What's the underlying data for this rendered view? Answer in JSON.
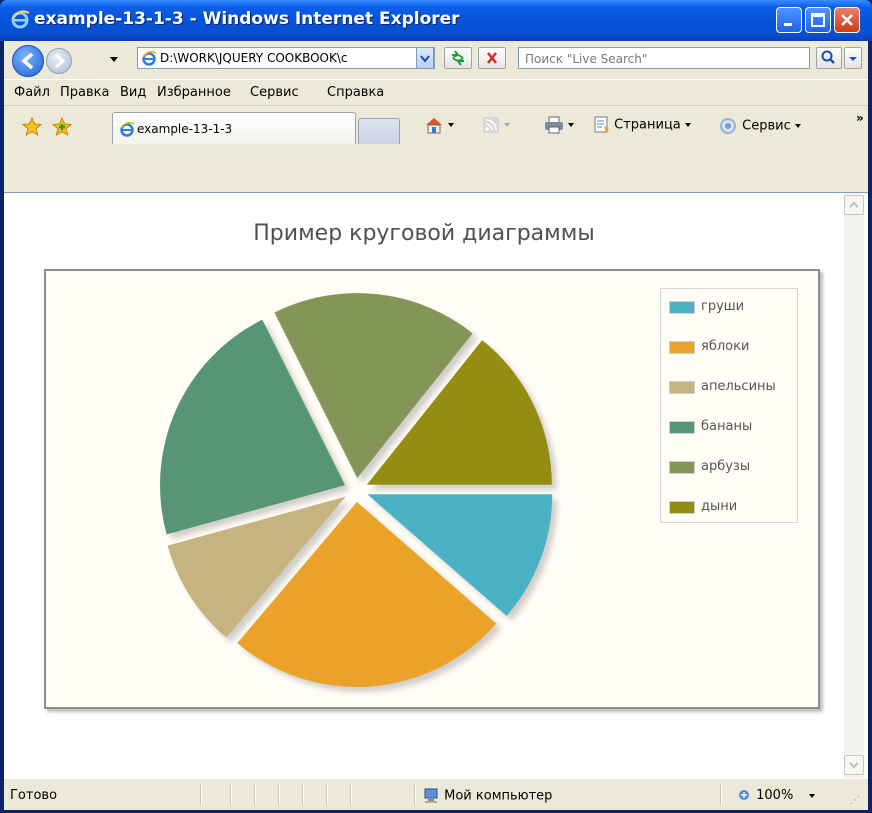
{
  "window": {
    "title": "example-13-1-3 - Windows Internet Explorer"
  },
  "address": {
    "url": "D:\\WORK\\JQUERY COOKBOOK\\c"
  },
  "search": {
    "placeholder": "Поиск \"Live Search\""
  },
  "menu": [
    "Файл",
    "Правка",
    "Вид",
    "Избранное",
    "Сервис",
    "Справка"
  ],
  "tab": {
    "label": "example-13-1-3"
  },
  "commandbar": {
    "page_label": "Страница",
    "tools_label": "Сервис"
  },
  "status": {
    "text": "Готово",
    "zone": "Мой компьютер",
    "zoom": "100%"
  },
  "icons": [
    "ie-logo-icon",
    "back-icon",
    "forward-icon",
    "refresh-icon",
    "stop-icon",
    "search-icon",
    "favorites-star-icon",
    "add-favorite-icon",
    "home-icon",
    "feeds-icon",
    "print-icon",
    "page-icon",
    "gear-icon",
    "computer-icon",
    "zoom-icon"
  ],
  "chart_data": {
    "type": "pie",
    "title": "Пример круговой диаграммы",
    "categories": [
      "груши",
      "яблоки",
      "апельсины",
      "бананы",
      "арбузы",
      "дыни"
    ],
    "values": [
      12,
      26,
      10,
      23,
      19,
      15
    ],
    "colors": [
      "#4bb2c5",
      "#eaa228",
      "#c5b47f",
      "#579575",
      "#839557",
      "#958c12"
    ],
    "legend": "top-right",
    "exploded": true,
    "shadow": true
  }
}
